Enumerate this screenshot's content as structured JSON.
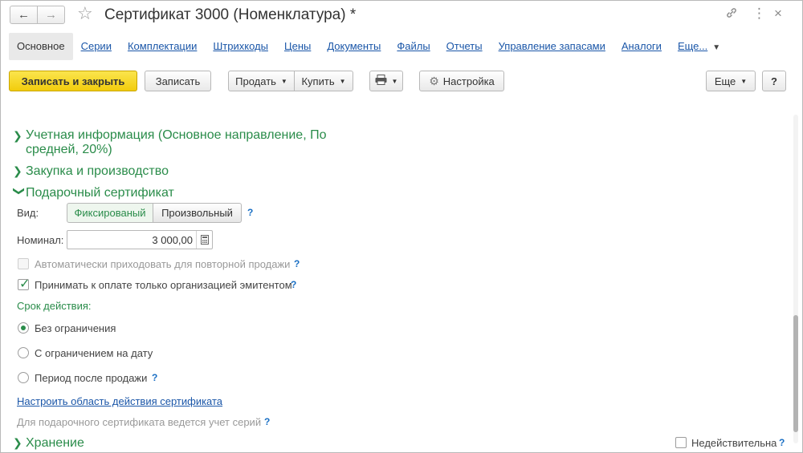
{
  "window": {
    "title": "Сертификат 3000 (Номенклатура) *",
    "back_icon": "arrow-left-icon",
    "forward_icon": "arrow-right-icon"
  },
  "tabs": [
    {
      "label": "Основное"
    },
    {
      "label": "Серии"
    },
    {
      "label": "Комплектации"
    },
    {
      "label": "Штрихкоды"
    },
    {
      "label": "Цены"
    },
    {
      "label": "Документы"
    },
    {
      "label": "Файлы"
    },
    {
      "label": "Отчеты"
    },
    {
      "label": "Управление запасами"
    },
    {
      "label": "Аналоги"
    },
    {
      "label": "Еще..."
    }
  ],
  "toolbar": {
    "save_close": "Записать и закрыть",
    "save": "Записать",
    "sell": "Продать",
    "buy": "Купить",
    "settings": "Настройка",
    "more": "Еще",
    "help": "?"
  },
  "groups": {
    "accounting": "Учетная информация (Основное направление, По средней, 20%)",
    "purchase": "Закупка и производство",
    "gift": "Подарочный сертификат",
    "storage": "Хранение"
  },
  "gift": {
    "kind_label": "Вид:",
    "kind_fixed": "Фиксированый",
    "kind_free": "Произвольный",
    "nominal_label": "Номинал:",
    "nominal_value": "3 000,00",
    "auto_receive": "Автоматически приходовать для повторной продажи",
    "accept_only": "Принимать к оплате только организацией эмитентом",
    "validity_label": "Срок действия:",
    "opt_unlimited": "Без ограничения",
    "opt_date": "С ограничением на дату",
    "opt_period": "Период после продажи",
    "scope_link": "Настроить область действия сертификата",
    "series_note": "Для подарочного сертификата ведется учет серий",
    "help": "?"
  },
  "inactive_label": "Недействительна",
  "colors": {
    "accent_green": "#2a8c4a",
    "link_blue": "#1a56a8",
    "primary_yellow": "#f2cc0c"
  }
}
